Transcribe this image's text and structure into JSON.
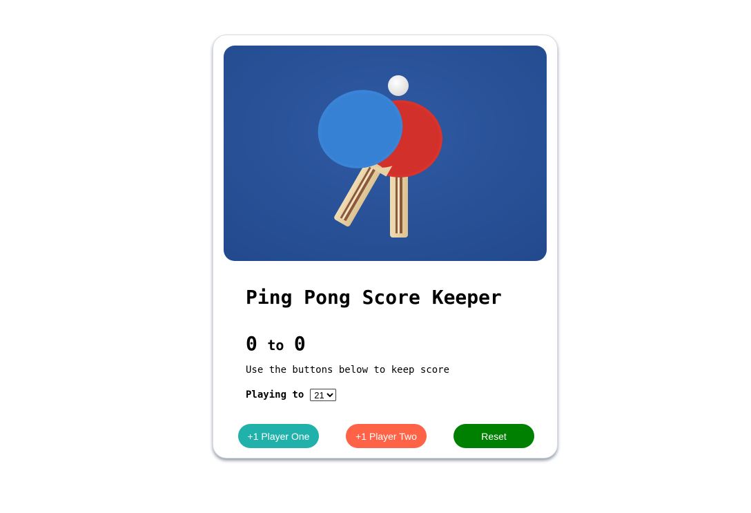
{
  "hero": {
    "image": "ping-pong-paddles-photo"
  },
  "title": "Ping Pong Score Keeper",
  "score": {
    "player_one": "0",
    "separator": "to",
    "player_two": "0"
  },
  "hint": "Use the buttons below to keep score",
  "playing_to": {
    "label": "Playing to",
    "selected": "21"
  },
  "buttons": {
    "player_one": "+1 Player One",
    "player_two": "+1 Player Two",
    "reset": "Reset"
  },
  "colors": {
    "player_one": "#20b2aa",
    "player_two": "#ff6347",
    "reset": "#008000",
    "hero_background": "#2a5298"
  }
}
